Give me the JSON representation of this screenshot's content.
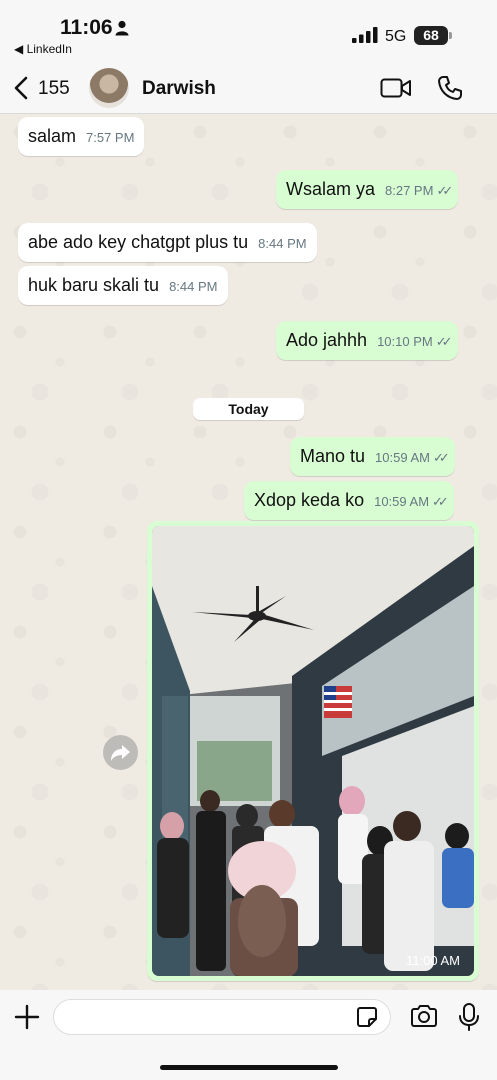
{
  "status_bar": {
    "time": "11:06",
    "back_app": "◀ LinkedIn",
    "network": "5G",
    "battery": "68"
  },
  "header": {
    "unread_count": "155",
    "contact_name": "Darwish"
  },
  "day_separator": "Today",
  "messages": [
    {
      "direction": "in",
      "text": "salam",
      "time": "7:57 PM"
    },
    {
      "direction": "out",
      "text": "Wsalam ya",
      "time": "8:27 PM"
    },
    {
      "direction": "in",
      "text": "abe ado key chatgpt plus tu",
      "time": "8:44 PM"
    },
    {
      "direction": "in",
      "text": "huk baru skali tu",
      "time": "8:44 PM"
    },
    {
      "direction": "out",
      "text": "Ado jahhh",
      "time": "10:10 PM"
    },
    {
      "direction": "out",
      "text": "Mano tu",
      "time": "10:59 AM"
    },
    {
      "direction": "out",
      "text": "Xdop keda ko",
      "time": "10:59 AM"
    }
  ],
  "image_message": {
    "time": "11:00 AM"
  },
  "colors": {
    "outgoing_bubble": "#d9fdd3",
    "incoming_bubble": "#ffffff",
    "wallpaper": "#efeae2"
  }
}
